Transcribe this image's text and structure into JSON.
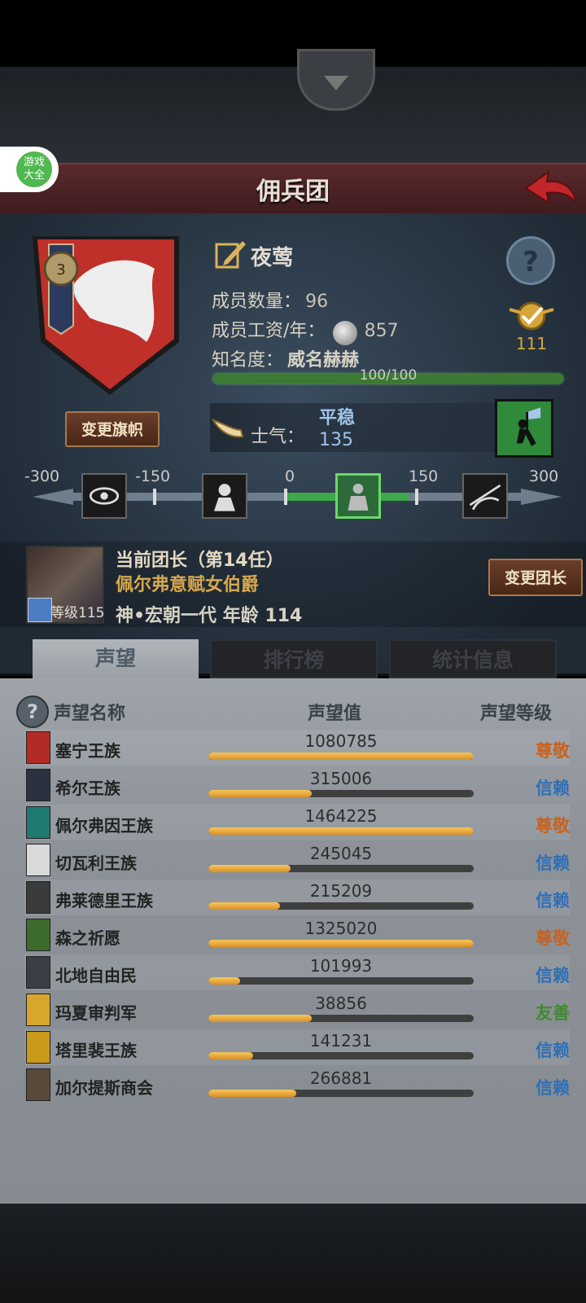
{
  "title": "佣兵团",
  "game_badge": "游戏\n大全",
  "guild": {
    "name": "夜莺",
    "members_label": "成员数量：",
    "members": "96",
    "salary_label": "成员工资/年：",
    "salary": "857",
    "fame_label": "知名度：",
    "fame_state": "威名赫赫",
    "fame_progress": "100/100",
    "fame_fraction": 1.0,
    "rank": "111",
    "help": "?"
  },
  "change_flag_button": "变更旗帜",
  "morale": {
    "label": "士气：",
    "state": "平稳",
    "value": "135"
  },
  "scale": {
    "ticks": [
      "-300",
      "-150",
      "0",
      "150",
      "300"
    ],
    "icons": [
      "eye-icon",
      "grief-icon",
      "calm-icon",
      "victory-icon"
    ],
    "active_index": 2
  },
  "leader": {
    "title": "当前团长（第14任）",
    "name": "佩尔弗意赋女伯爵",
    "level": "等级115",
    "generation": "神•宏朝一代  年龄 114"
  },
  "change_leader_button": "变更团长",
  "tabs": [
    "声望",
    "排行榜",
    "统计信息"
  ],
  "reputation_headers": [
    "声望名称",
    "声望值",
    "声望等级"
  ],
  "reputation": [
    {
      "name": "塞宁王族",
      "value": "1080785",
      "fill": 1.0,
      "level": "尊敬",
      "color": "#c8621f",
      "icon_color": "#b32b25"
    },
    {
      "name": "希尔王族",
      "value": "315006",
      "fill": 0.39,
      "level": "信赖",
      "color": "#2f6eb5",
      "icon_color": "#2b3140"
    },
    {
      "name": "佩尔弗因王族",
      "value": "1464225",
      "fill": 1.0,
      "level": "尊敬",
      "color": "#c8621f",
      "icon_color": "#1f7a72"
    },
    {
      "name": "切瓦利王族",
      "value": "245045",
      "fill": 0.31,
      "level": "信赖",
      "color": "#2f6eb5",
      "icon_color": "#d9d9d9"
    },
    {
      "name": "弗莱德里王族",
      "value": "215209",
      "fill": 0.27,
      "level": "信赖",
      "color": "#2f6eb5",
      "icon_color": "#3b3b3b"
    },
    {
      "name": "森之祈愿",
      "value": "1325020",
      "fill": 1.0,
      "level": "尊敬",
      "color": "#c8621f",
      "icon_color": "#3d6b2c"
    },
    {
      "name": "北地自由民",
      "value": "101993",
      "fill": 0.12,
      "level": "信赖",
      "color": "#2f6eb5",
      "icon_color": "#3a3f45"
    },
    {
      "name": "玛夏审判军",
      "value": "38856",
      "fill": 0.39,
      "level": "友善",
      "color": "#3f8a2f",
      "icon_color": "#d8a62a"
    },
    {
      "name": "塔里裴王族",
      "value": "141231",
      "fill": 0.17,
      "level": "信赖",
      "color": "#2f6eb5",
      "icon_color": "#c99a1a"
    },
    {
      "name": "加尔提斯商会",
      "value": "266881",
      "fill": 0.33,
      "level": "信赖",
      "color": "#2f6eb5",
      "icon_color": "#5a4a3a"
    }
  ]
}
